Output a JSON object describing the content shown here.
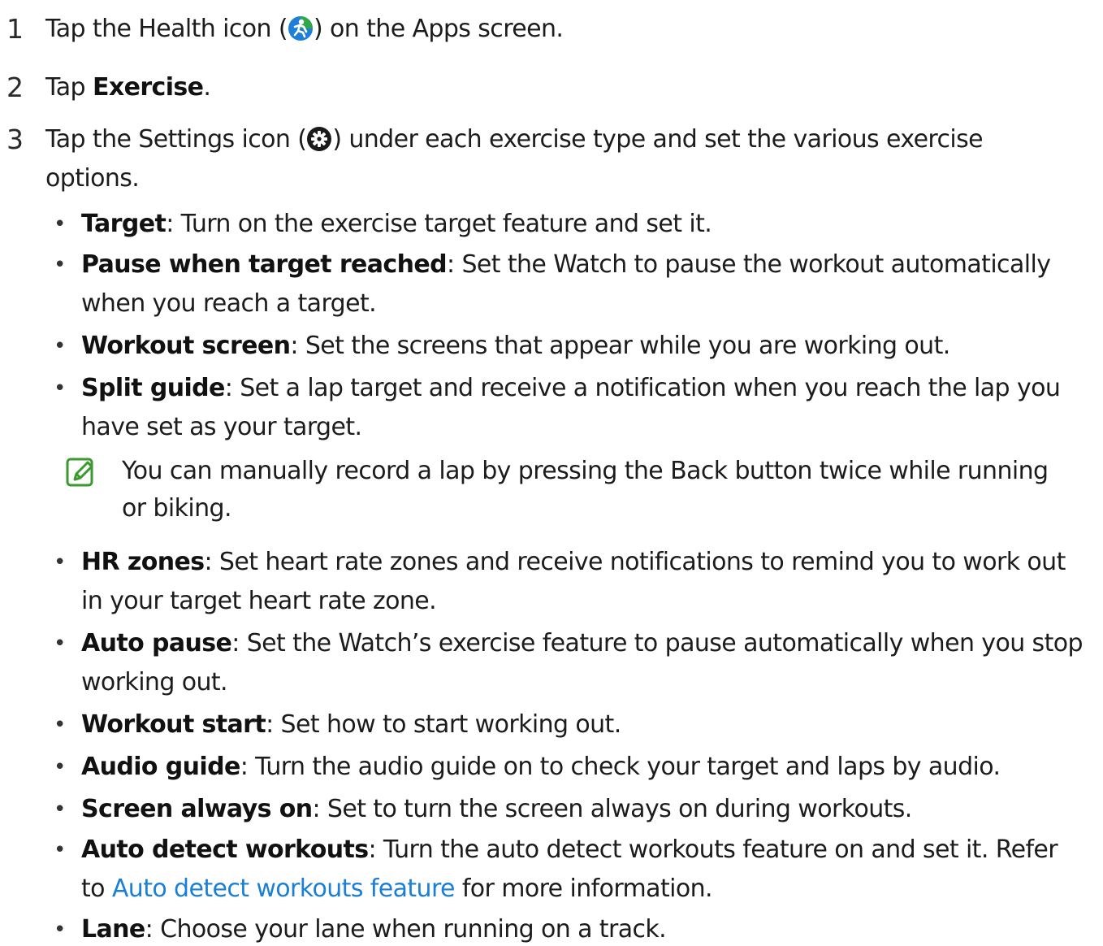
{
  "steps": [
    {
      "number": "1",
      "pre": "Tap the Health icon (",
      "icon": "health-icon",
      "post": ") on the Apps screen."
    },
    {
      "number": "2",
      "pre": "Tap ",
      "bold": "Exercise",
      "post": "."
    },
    {
      "number": "3",
      "pre": "Tap the Settings icon (",
      "icon": "settings-icon",
      "post": ") under each exercise type and set the various exercise",
      "cont": "options."
    }
  ],
  "options": [
    {
      "bold": "Target",
      "text": ": Turn on the exercise target feature and set it."
    },
    {
      "bold": "Pause when target reached",
      "text": ": Set the Watch to pause the workout automatically",
      "cont": "when you reach a target."
    },
    {
      "bold": "Workout screen",
      "text": ": Set the screens that appear while you are working out."
    },
    {
      "bold": "Split guide",
      "text": ": Set a lap target and receive a notification when you reach the lap you",
      "cont": "have set as your target."
    },
    {
      "bold": "HR zones",
      "text": ": Set heart rate zones and receive notifications to remind you to work out",
      "cont": "in your target heart rate zone."
    },
    {
      "bold": "Auto pause",
      "text": ": Set the Watch’s exercise feature to pause automatically when you stop",
      "cont": "working out."
    },
    {
      "bold": "Workout start",
      "text": ": Set how to start working out."
    },
    {
      "bold": "Audio guide",
      "text": ": Turn the audio guide on to check your target and laps by audio."
    },
    {
      "bold": "Screen always on",
      "text": ": Set to turn the screen always on during workouts."
    },
    {
      "bold": "Auto detect workouts",
      "text": ": Turn the auto detect workouts feature on and set it. Refer",
      "cont_link": "Auto detect workouts feature",
      "cont_pre": "to ",
      "cont_post": " for more information."
    },
    {
      "bold": "Lane",
      "text": ": Choose your lane when running on a track."
    }
  ],
  "note": {
    "icon": "note-icon",
    "line1": "You can manually record a lap by pressing the Back button twice while running",
    "line2": "or biking."
  },
  "bullet_char": "•",
  "colors": {
    "text": "#1c1c1c",
    "link": "#1a7fd6",
    "note_icon": "#3a9a2e",
    "health_icon": "#1f7fd8"
  }
}
